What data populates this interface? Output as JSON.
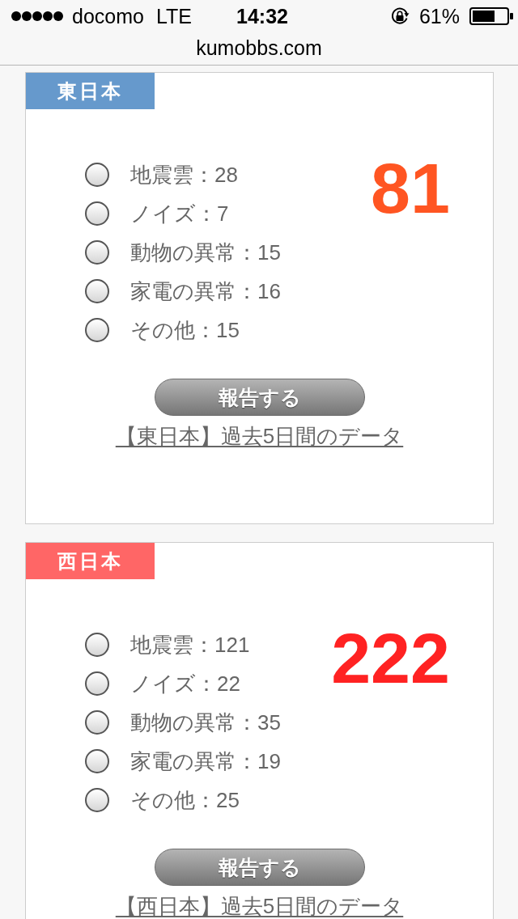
{
  "status_bar": {
    "carrier": "docomo",
    "network": "LTE",
    "time": "14:32",
    "battery": "61%"
  },
  "address_bar": {
    "url": "kumobbs.com"
  },
  "regions": [
    {
      "title": "東日本",
      "color": "#6699cc",
      "options": [
        {
          "label": "地震雲：28",
          "selected": false
        },
        {
          "label": "ノイズ：7",
          "selected": false
        },
        {
          "label": "動物の異常：15",
          "selected": false
        },
        {
          "label": "家電の異常：16",
          "selected": false
        },
        {
          "label": "その他：15",
          "selected": false
        }
      ],
      "total": {
        "value": "81",
        "color": "#ff5522"
      },
      "button": "報告する",
      "link": "【東日本】過去5日間のデータ"
    },
    {
      "title": "西日本",
      "color": "#ff6666",
      "options": [
        {
          "label": "地震雲：121",
          "selected": false
        },
        {
          "label": "ノイズ：22",
          "selected": false
        },
        {
          "label": "動物の異常：35",
          "selected": false
        },
        {
          "label": "家電の異常：19",
          "selected": false
        },
        {
          "label": "その他：25",
          "selected": false
        }
      ],
      "total": {
        "value": "222",
        "color": "#ff2222"
      },
      "button": "報告する",
      "link": "【西日本】過去5日間のデータ"
    }
  ]
}
